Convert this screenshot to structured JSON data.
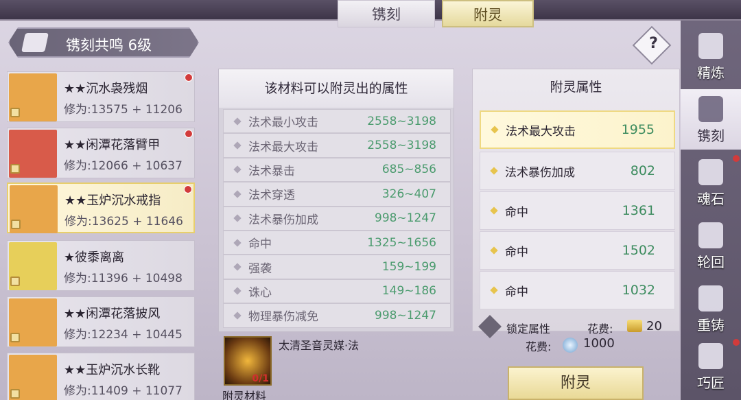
{
  "title": "镌刻",
  "resonance": {
    "label": "镌刻共鸣 6级"
  },
  "tabs": [
    {
      "label": "镌刻"
    },
    {
      "label": "附灵"
    }
  ],
  "help": {
    "label": "?"
  },
  "items": [
    {
      "name": "★★沉水袅残烟",
      "stat": "修为:13575 + 11206",
      "thumb_color": "#e8a64a",
      "has_dot": true
    },
    {
      "name": "★★闲潭花落臂甲",
      "stat": "修为:12066 + 10637",
      "thumb_color": "#d85b4a",
      "has_dot": true
    },
    {
      "name": "★★玉炉沉水戒指",
      "stat": "修为:13625 + 11646",
      "thumb_color": "#e8a64a",
      "has_dot": true,
      "selected": true
    },
    {
      "name": "★彼黍离离",
      "stat": "修为:11396 + 10498",
      "thumb_color": "#e7cf5a",
      "has_dot": false
    },
    {
      "name": "★★闲潭花落披风",
      "stat": "修为:12234 + 10445",
      "thumb_color": "#e8a64a",
      "has_dot": false
    },
    {
      "name": "★★玉炉沉水长靴",
      "stat": "修为:11409 + 11077",
      "thumb_color": "#e8a64a",
      "has_dot": false
    }
  ],
  "material_panel": {
    "header": "该材料可以附灵出的属性",
    "rows": [
      {
        "name": "法术最小攻击",
        "value": "2558~3198"
      },
      {
        "name": "法术最大攻击",
        "value": "2558~3198"
      },
      {
        "name": "法术暴击",
        "value": "685~856"
      },
      {
        "name": "法术穿透",
        "value": "326~407"
      },
      {
        "name": "法术暴伤加成",
        "value": "998~1247"
      },
      {
        "name": "命中",
        "value": "1325~1656"
      },
      {
        "name": "强袭",
        "value": "159~199"
      },
      {
        "name": "诛心",
        "value": "149~186"
      },
      {
        "name": "物理暴伤减免",
        "value": "998~1247"
      }
    ]
  },
  "material": {
    "count": "0/1",
    "label": "附灵材料",
    "name": "太清圣音灵媒·法"
  },
  "enchant_panel": {
    "header": "附灵属性",
    "attrs": [
      {
        "name": "法术最大攻击",
        "value": "1955"
      },
      {
        "name": "法术暴伤加成",
        "value": "802"
      },
      {
        "name": "命中",
        "value": "1361"
      },
      {
        "name": "命中",
        "value": "1502"
      },
      {
        "name": "命中",
        "value": "1032"
      }
    ]
  },
  "lock": {
    "label": "锁定属性"
  },
  "cost1": {
    "label": "花费:",
    "value": "20"
  },
  "cost2": {
    "label": "花费:",
    "value": "1000"
  },
  "enchant_button": {
    "label": "附灵"
  },
  "sidebar": [
    {
      "label": "精炼",
      "icon": "refine-icon",
      "has_dot": false
    },
    {
      "label": "镌刻",
      "icon": "engrave-icon",
      "active": true,
      "has_dot": false
    },
    {
      "label": "魂石",
      "icon": "soulstone-icon",
      "has_dot": true
    },
    {
      "label": "轮回",
      "icon": "reincarnation-icon",
      "has_dot": false
    },
    {
      "label": "重铸",
      "icon": "recast-icon",
      "has_dot": false
    },
    {
      "label": "巧匠",
      "icon": "craftsman-icon",
      "has_dot": true
    }
  ]
}
